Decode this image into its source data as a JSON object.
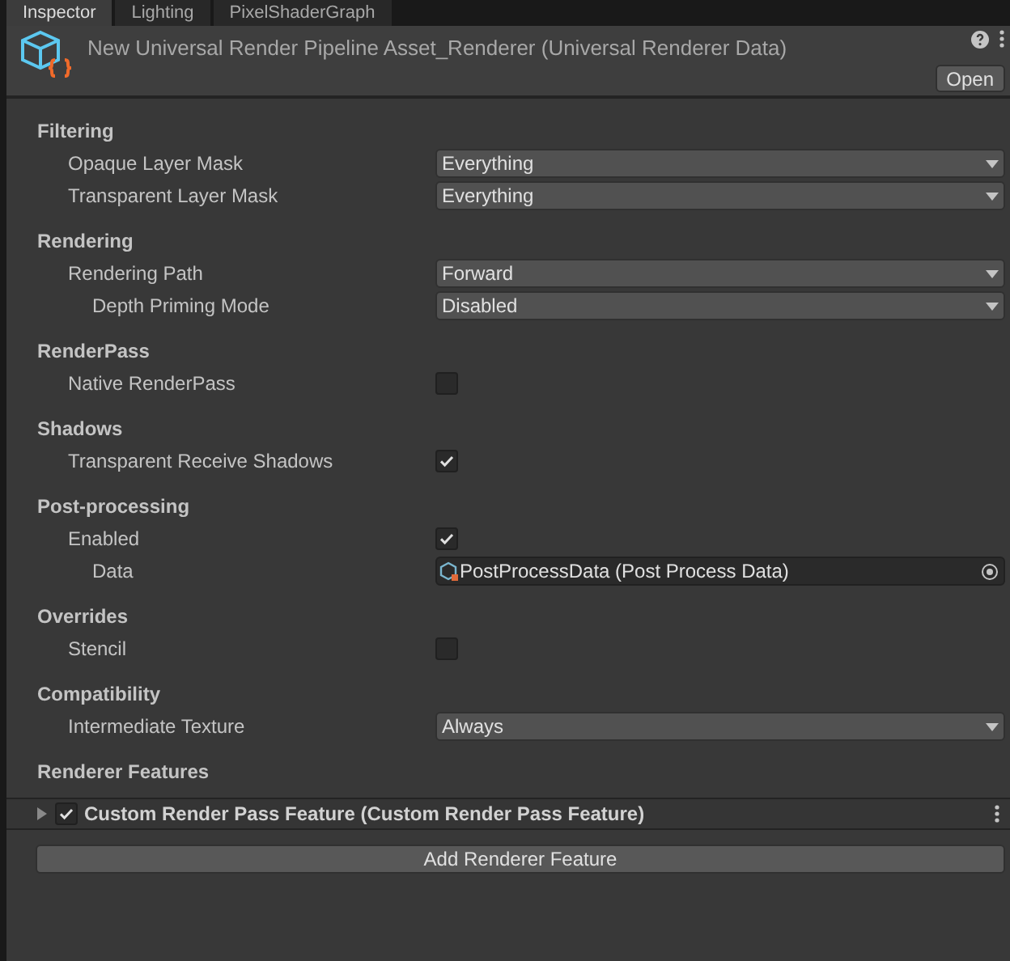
{
  "tabs": [
    {
      "label": "Inspector",
      "selected": true
    },
    {
      "label": "Lighting",
      "selected": false
    },
    {
      "label": "PixelShaderGraph",
      "selected": false
    }
  ],
  "header": {
    "title": "New Universal Render Pipeline Asset_Renderer (Universal Renderer Data)",
    "open_button": "Open"
  },
  "sections": [
    {
      "title": "Filtering",
      "fields": [
        {
          "kind": "dropdown",
          "label": "Opaque Layer Mask",
          "value": "Everything"
        },
        {
          "kind": "dropdown",
          "label": "Transparent Layer Mask",
          "value": "Everything"
        }
      ]
    },
    {
      "title": "Rendering",
      "fields": [
        {
          "kind": "dropdown",
          "label": "Rendering Path",
          "value": "Forward",
          "children": [
            {
              "kind": "dropdown",
              "label": "Depth Priming Mode",
              "value": "Disabled"
            }
          ]
        }
      ]
    },
    {
      "title": "RenderPass",
      "fields": [
        {
          "kind": "checkbox",
          "label": "Native RenderPass",
          "checked": false
        }
      ]
    },
    {
      "title": "Shadows",
      "fields": [
        {
          "kind": "checkbox",
          "label": "Transparent Receive Shadows",
          "checked": true
        }
      ]
    },
    {
      "title": "Post-processing",
      "fields": [
        {
          "kind": "checkbox",
          "label": "Enabled",
          "checked": true,
          "children": [
            {
              "kind": "object",
              "label": "Data",
              "value": "PostProcessData (Post Process Data)"
            }
          ]
        }
      ]
    },
    {
      "title": "Overrides",
      "fields": [
        {
          "kind": "checkbox",
          "label": "Stencil",
          "checked": false
        }
      ]
    },
    {
      "title": "Compatibility",
      "fields": [
        {
          "kind": "dropdown",
          "label": "Intermediate Texture",
          "value": "Always"
        }
      ]
    }
  ],
  "renderer_features": {
    "title": "Renderer Features",
    "items": [
      {
        "label": "Custom Render Pass Feature (Custom Render Pass Feature)",
        "enabled": true,
        "expanded": false
      }
    ],
    "add_button": "Add Renderer Feature"
  }
}
